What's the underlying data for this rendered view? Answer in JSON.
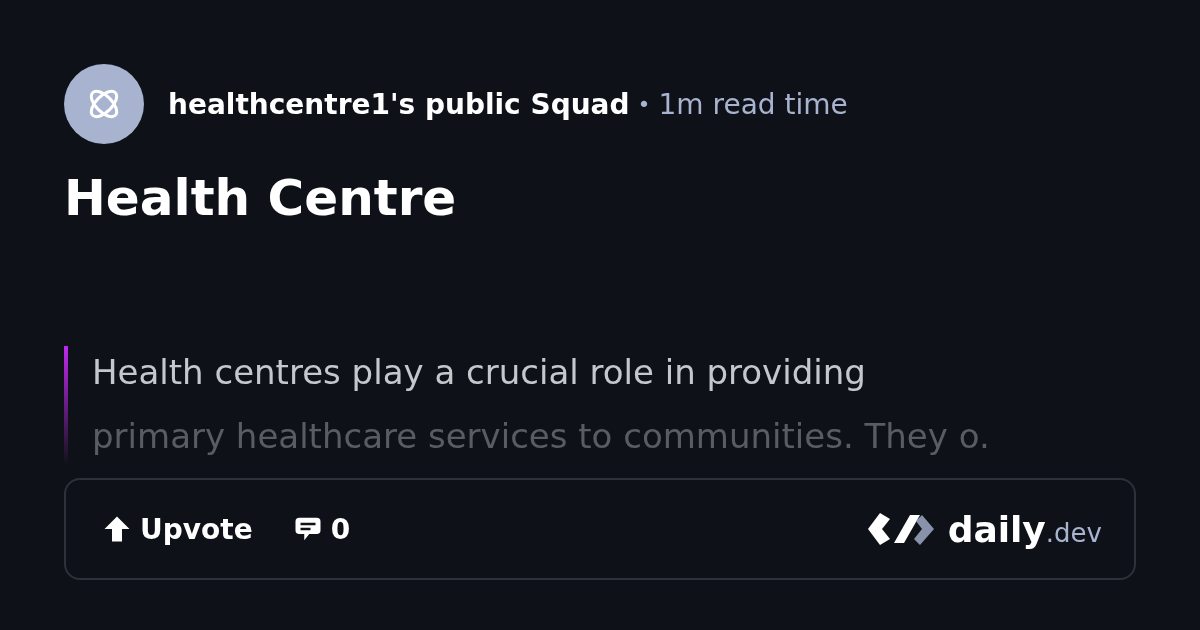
{
  "source": {
    "name": "healthcentre1's public Squad",
    "separator": "•",
    "read_time": "1m read time"
  },
  "title": "Health Centre",
  "summary": {
    "lines": [
      "Health centres play a crucial role in providing",
      "primary healthcare services to communities. They o."
    ]
  },
  "footer": {
    "upvote": "Upvote",
    "comments": "0",
    "brand": {
      "name": "daily",
      "suffix": ".dev"
    }
  }
}
